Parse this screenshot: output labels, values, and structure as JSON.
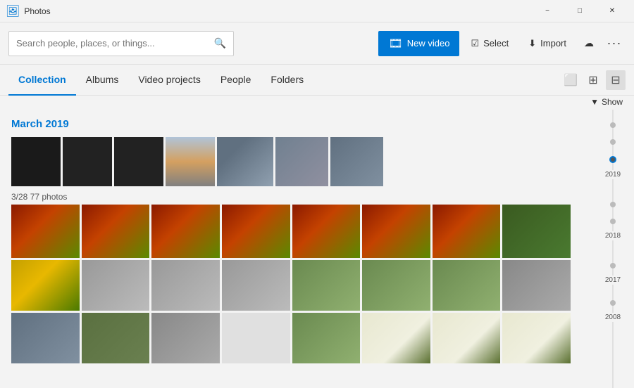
{
  "app": {
    "title": "Photos"
  },
  "titlebar": {
    "minimize_label": "−",
    "maximize_label": "□",
    "close_label": "✕"
  },
  "header": {
    "search_placeholder": "Search people, places, or things...",
    "new_video_label": "New video",
    "select_label": "Select",
    "import_label": "Import",
    "more_label": "···"
  },
  "nav": {
    "tabs": [
      {
        "id": "collection",
        "label": "Collection",
        "active": true
      },
      {
        "id": "albums",
        "label": "Albums",
        "active": false
      },
      {
        "id": "video-projects",
        "label": "Video projects",
        "active": false
      },
      {
        "id": "people",
        "label": "People",
        "active": false
      },
      {
        "id": "folders",
        "label": "Folders",
        "active": false
      }
    ]
  },
  "show_label": "Show",
  "sections": [
    {
      "date": "March 2019",
      "day_label": "3/28  77 photos"
    }
  ],
  "timeline": {
    "years": [
      {
        "label": "2019",
        "active": true
      },
      {
        "label": "2018",
        "active": false
      },
      {
        "label": "2017",
        "active": false
      },
      {
        "label": "2008",
        "active": false
      }
    ]
  }
}
